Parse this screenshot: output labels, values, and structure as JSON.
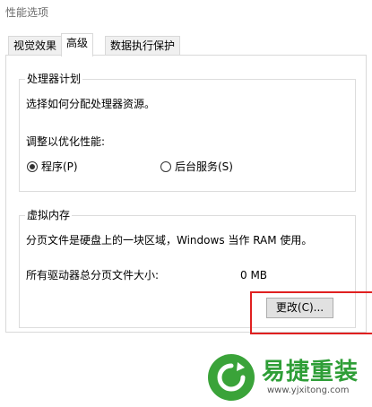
{
  "window": {
    "title": "性能选项"
  },
  "tabs": [
    {
      "label": "视觉效果"
    },
    {
      "label": "高级"
    },
    {
      "label": "数据执行保护"
    }
  ],
  "processor": {
    "title": "处理器计划",
    "description": "选择如何分配处理器资源。",
    "optimize_label": "调整以优化性能:",
    "options": [
      {
        "label": "程序(P)",
        "selected": true
      },
      {
        "label": "后台服务(S)",
        "selected": false
      }
    ]
  },
  "virtual_memory": {
    "title": "虚拟内存",
    "description": "分页文件是硬盘上的一块区域，Windows 当作 RAM 使用。",
    "total_label": "所有驱动器总分页文件大小:",
    "total_value": "0 MB",
    "change_button": "更改(C)..."
  },
  "watermark": {
    "brand": "易捷重装",
    "url": "www.yjxitong.com"
  },
  "colors": {
    "highlight": "#e02020",
    "brand_green": "#3aa339"
  }
}
